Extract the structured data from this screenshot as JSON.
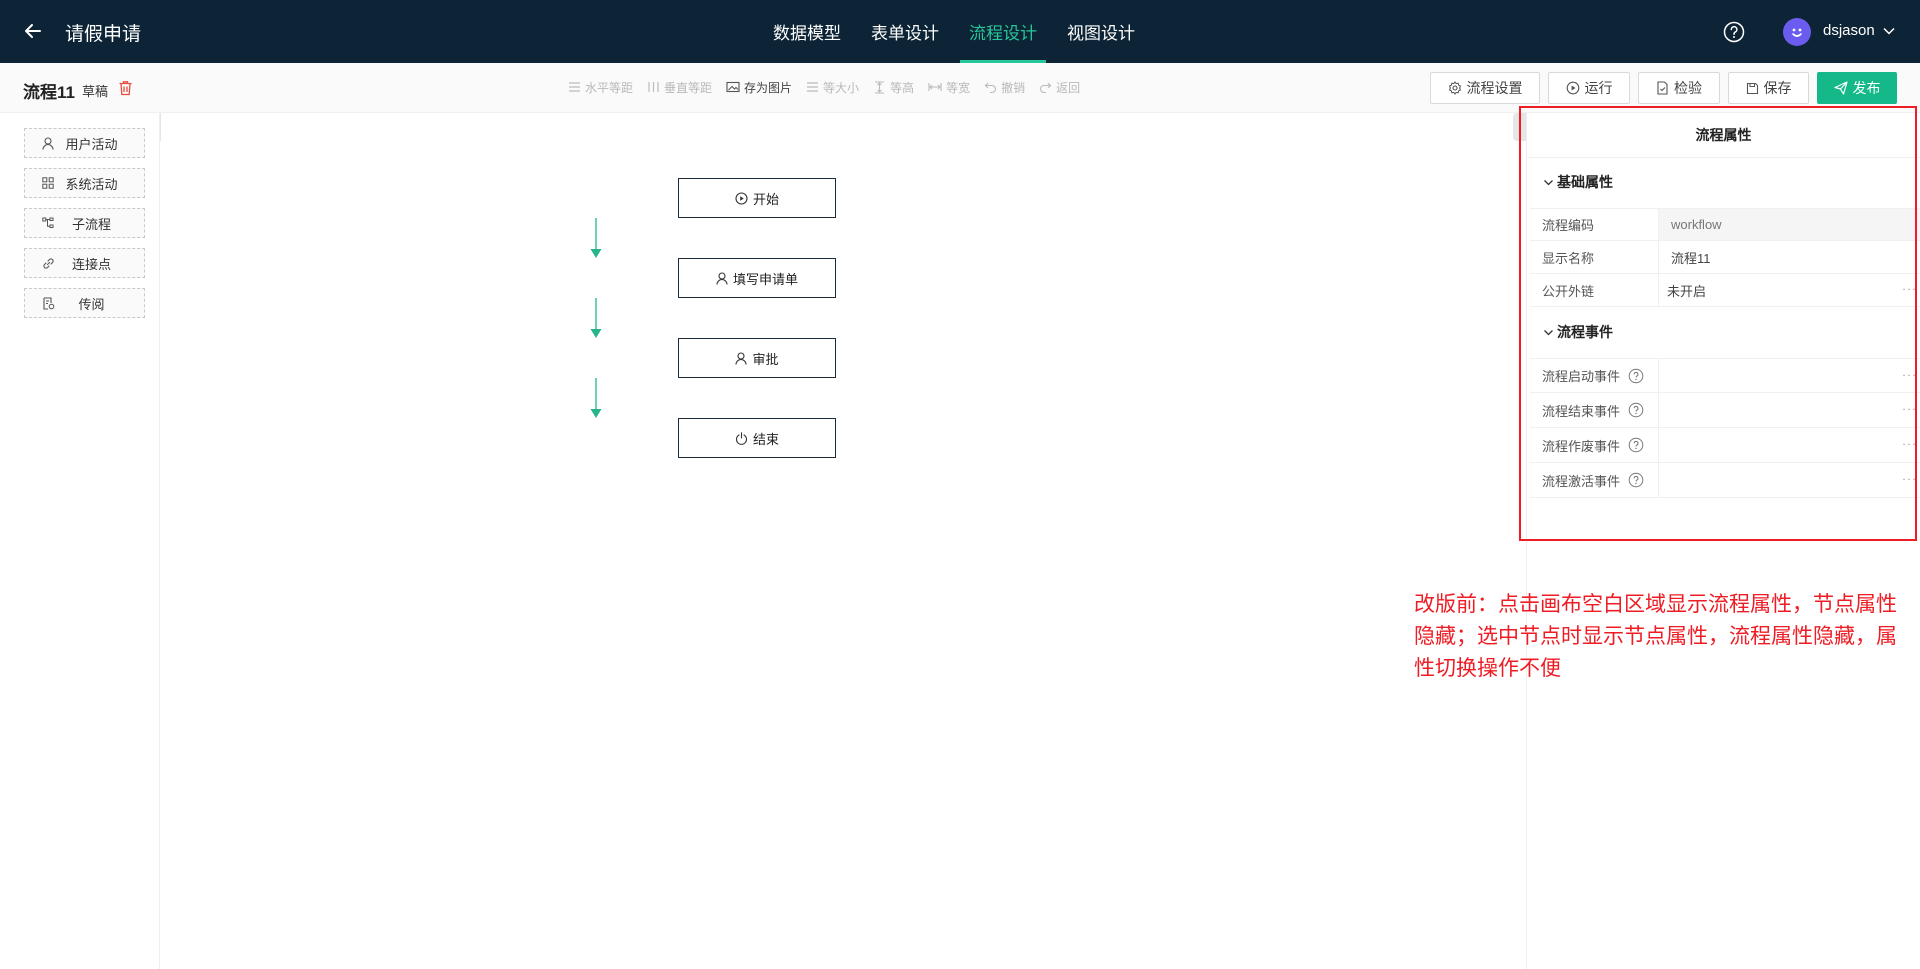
{
  "header": {
    "title": "请假申请",
    "tabs": [
      {
        "label": "数据模型"
      },
      {
        "label": "表单设计"
      },
      {
        "label": "流程设计"
      },
      {
        "label": "视图设计"
      }
    ],
    "active_tab": "流程设计",
    "username": "dsjason",
    "avatar_color": "#6b5cf0",
    "accent_color": "#28c79a"
  },
  "toolbar": {
    "flow_name": "流程11",
    "status": "草稿",
    "tools": [
      {
        "label": "水平等距",
        "icon": "align-horizontal-icon",
        "enabled": false
      },
      {
        "label": "垂直等距",
        "icon": "align-vertical-icon",
        "enabled": false
      },
      {
        "label": "存为图片",
        "icon": "image-icon",
        "enabled": true
      },
      {
        "label": "等大小",
        "icon": "same-size-icon",
        "enabled": false
      },
      {
        "label": "等高",
        "icon": "same-height-icon",
        "enabled": false
      },
      {
        "label": "等宽",
        "icon": "same-width-icon",
        "enabled": false
      },
      {
        "label": "撤销",
        "icon": "undo-icon",
        "enabled": false
      },
      {
        "label": "返回",
        "icon": "redo-icon",
        "enabled": false
      }
    ],
    "actions": {
      "settings": "流程设置",
      "run": "运行",
      "check": "检验",
      "save": "保存",
      "publish": "发布"
    }
  },
  "palette": {
    "items": [
      {
        "label": "用户活动",
        "icon": "user-icon"
      },
      {
        "label": "系统活动",
        "icon": "grid-icon"
      },
      {
        "label": "子流程",
        "icon": "subflow-icon"
      },
      {
        "label": "连接点",
        "icon": "link-icon"
      },
      {
        "label": "传阅",
        "icon": "circulate-icon"
      }
    ]
  },
  "canvas": {
    "nodes": [
      {
        "label": "开始",
        "icon": "play-icon"
      },
      {
        "label": "填写申请单",
        "icon": "user-icon"
      },
      {
        "label": "审批",
        "icon": "user-icon"
      },
      {
        "label": "结束",
        "icon": "power-icon"
      }
    ],
    "edge_color": "#28b48c"
  },
  "properties": {
    "title": "流程属性",
    "basic": {
      "header": "基础属性",
      "rows": [
        {
          "label": "流程编码",
          "value": "workflow"
        },
        {
          "label": "显示名称",
          "value": "流程11"
        },
        {
          "label": "公开外链",
          "value": "未开启",
          "more": "···"
        }
      ]
    },
    "events": {
      "header": "流程事件",
      "rows": [
        {
          "label": "流程启动事件",
          "value": "",
          "more": "···"
        },
        {
          "label": "流程结束事件",
          "value": "",
          "more": "···"
        },
        {
          "label": "流程作废事件",
          "value": "",
          "more": "···"
        },
        {
          "label": "流程激活事件",
          "value": "",
          "more": "···"
        }
      ]
    }
  },
  "annotation": {
    "text": "改版前：点击画布空白区域显示流程属性，节点属性隐藏；选中节点时显示节点属性，流程属性隐藏，属性切换操作不便",
    "color": "#ee1c24"
  }
}
